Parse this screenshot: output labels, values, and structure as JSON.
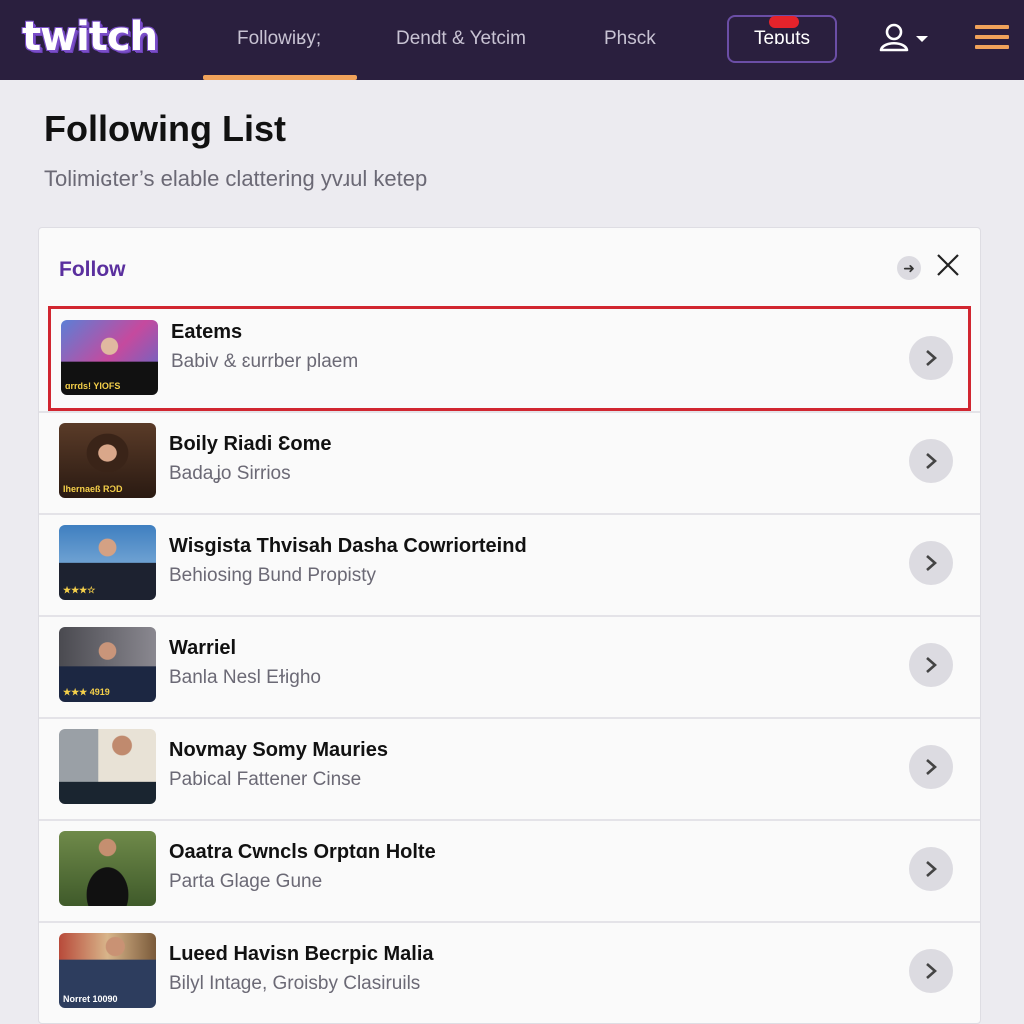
{
  "header": {
    "logo": "twitch",
    "nav": [
      {
        "label": "Followiʁy;",
        "active": true
      },
      {
        "label": "Dendt & Yetcim",
        "active": false
      },
      {
        "label": "Phsck",
        "active": false
      }
    ],
    "button_label": "Teɒuts",
    "accent_color": "#f0a25a",
    "badge_color": "#e5232b",
    "user_icon": "user-icon",
    "menu_icon": "hamburger-menu-icon"
  },
  "page": {
    "title": "Following List",
    "subtitle": "Tolimiɢter’s elable clattering yvɹul ketep"
  },
  "panel": {
    "title": "Follow",
    "title_color": "#5a2f9e",
    "selected_border_color": "#d12630",
    "items": [
      {
        "title": "Eatems",
        "subtitle": "Babiv & ɛurrber plaem",
        "badge": "ɑrrdsǃ YIOFS",
        "selected": true
      },
      {
        "title": "Boily Riadi Ɛome",
        "subtitle": "Badaʝo Sirrios",
        "badge": "Ihernaeß RƆD",
        "selected": false
      },
      {
        "title": "Wisgista Thvisah Dasha Cowriorteind",
        "subtitle": "Behiosing Bund Propisty",
        "badge": "★★★☆",
        "selected": false
      },
      {
        "title": "Warriel",
        "subtitle": "Banla Nesl Eɫigho",
        "badge": "★★★ 4919",
        "selected": false
      },
      {
        "title": "Novmay Somy Mauries",
        "subtitle": "Pabical Fattener Cinse",
        "badge": "",
        "selected": false
      },
      {
        "title": "Oaatra Cwncls Orptɑn Holte",
        "subtitle": "Parta Glage Gune",
        "badge": "",
        "selected": false
      },
      {
        "title": "Lueed Havisn Becrpic Malia",
        "subtitle": "Bilyl Intage, Groisby Clasiruils",
        "badge": "Norret 10090",
        "selected": false
      }
    ]
  }
}
